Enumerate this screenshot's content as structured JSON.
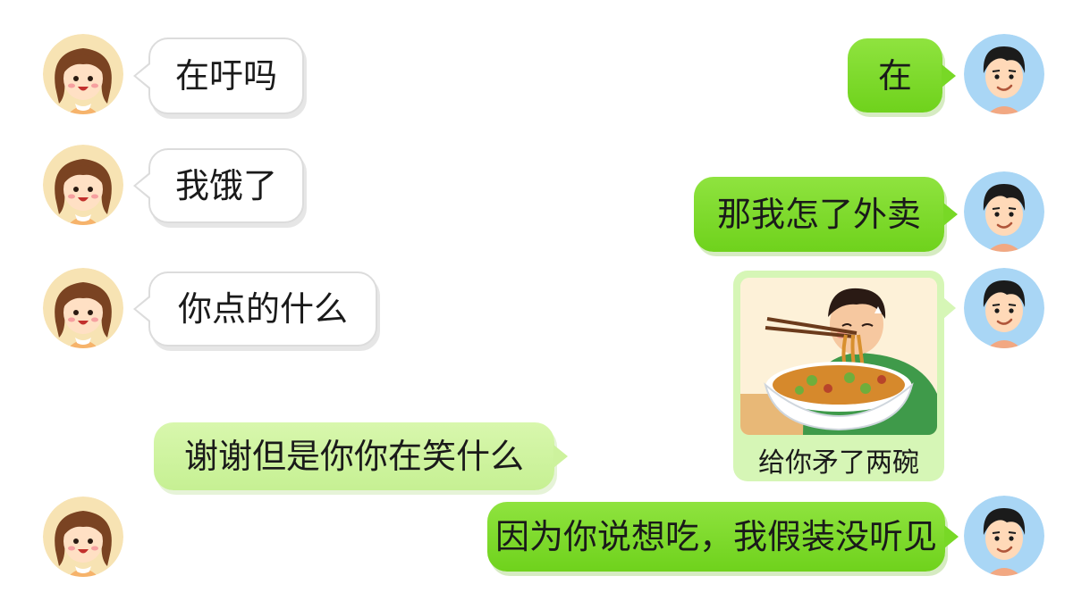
{
  "conversation": {
    "messages": [
      {
        "sender": "girl",
        "type": "text",
        "text": "在吁吗"
      },
      {
        "sender": "boy",
        "type": "text",
        "text": "在"
      },
      {
        "sender": "girl",
        "type": "text",
        "text": "我饿了"
      },
      {
        "sender": "boy",
        "type": "text",
        "text": "那我怎了外卖"
      },
      {
        "sender": "girl",
        "type": "text",
        "text": "你点的什么"
      },
      {
        "sender": "boy",
        "type": "image",
        "image_description": "boy-eating-noodles",
        "caption": "给你矛了两碗"
      },
      {
        "sender": "girl",
        "type": "text",
        "text": "谢谢但是你你在笑什么"
      },
      {
        "sender": "boy",
        "type": "text",
        "text": "因为你说想吃，我假装没听见"
      }
    ]
  },
  "colors": {
    "green_bubble": "#7ad628",
    "light_green_bubble": "#cdf29d",
    "white_bubble": "#ffffff",
    "girl_avatar_bg": "#f7e3b3",
    "boy_avatar_bg": "#a9d6f5"
  },
  "avatars": {
    "girl": "girl-avatar-icon",
    "boy": "boy-avatar-icon"
  }
}
